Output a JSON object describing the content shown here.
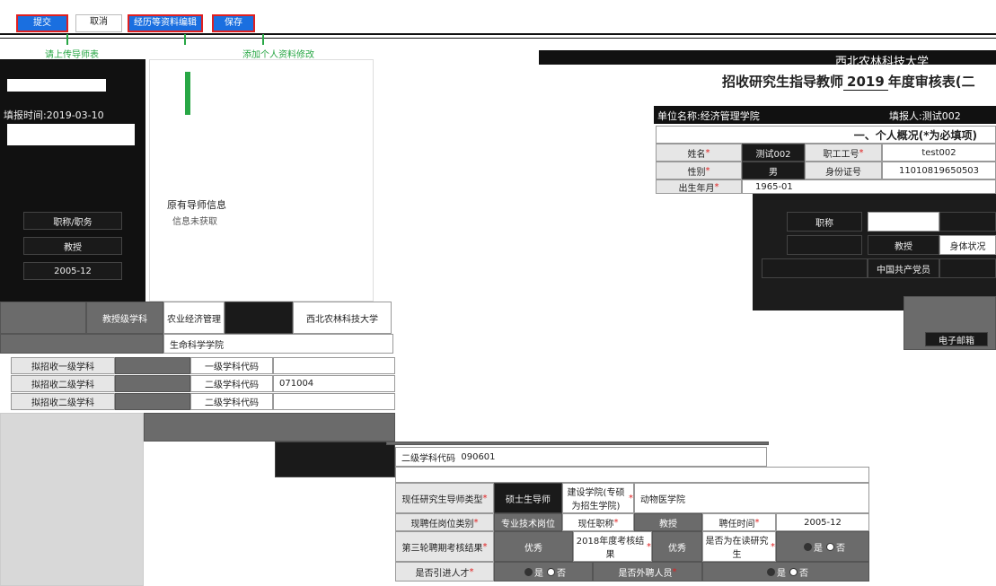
{
  "toolbar": {
    "submit": "提交",
    "cancel": "取消",
    "experience": "经历等资料编辑",
    "save": "保存"
  },
  "hints": {
    "edit_teach": "请上传导师表",
    "personal_edit": "添加个人资料修改"
  },
  "left_panel": {
    "date_label": "填报时间:2019-03-10",
    "row_a": "职称/职务",
    "row_b": "教授",
    "row_c": "2005-12",
    "row_d": "教授级学科",
    "row_e": "农业经济管理",
    "row_f": "西北农林科技大学",
    "row_g": "生命科学学院"
  },
  "info_panel": {
    "title": "原有导师信息",
    "message": "信息未获取"
  },
  "header": {
    "university": "西北农林科技大学",
    "form_title": "招收研究生指导教师",
    "year": "2019",
    "form_suffix": "年度审核表(二",
    "unit_label": "单位名称:经济管理学院",
    "filler_label": "填报人:测试002"
  },
  "section1": {
    "title": "一、个人概况(*为必填项)",
    "name_label": "姓名",
    "name_value": "测试002",
    "staff_id_label": "职工工号",
    "staff_id_value": "test002",
    "gender_label": "性别",
    "gender_value": "男",
    "id_card_label": "身份证号",
    "id_card_value": "11010819650503",
    "birth_label": "出生年月",
    "birth_value": "1965-01"
  },
  "right_panel": {
    "title_label": "职称",
    "title_value": "教授",
    "health_label": "身体状况",
    "party_label": "中国共产党员",
    "email_label": "电子邮箱"
  },
  "discipline_rows": [
    {
      "label": "拟招收一级学科",
      "code_label": "一级学科代码",
      "code": ""
    },
    {
      "label": "拟招收二级学科",
      "code_label": "二级学科代码",
      "code": "071004"
    },
    {
      "label": "拟招收二级学科",
      "code_label": "二级学科代码",
      "code": ""
    }
  ],
  "lower_form": {
    "second_code_label": "二级学科代码",
    "second_code_value": "090601",
    "tutor_type_label": "现任研究生导师类型",
    "tutor_type_value": "硕士生导师",
    "college_label": "建设学院(专硕为招生学院)",
    "college_value": "动物医学院",
    "post_label": "现聘任岗位类别",
    "post_value": "专业技术岗位",
    "current_title_label": "现任职称",
    "current_title_value": "教授",
    "appoint_time_label": "聘任时间",
    "appoint_time_value": "2005-12",
    "third_eval_label": "第三轮聘期考核结果",
    "third_eval_value": "优秀",
    "annual_eval_label": "2018年度考核结果",
    "annual_eval_value": "优秀",
    "student_label": "是否为在读研究生",
    "yes": "是",
    "no": "否",
    "talent_label": "是否引进人才",
    "foreign_label": "是否外聘人员"
  },
  "colors": {
    "primary": "#1a6fe0",
    "danger": "#e02020",
    "hint": "#28a745"
  }
}
